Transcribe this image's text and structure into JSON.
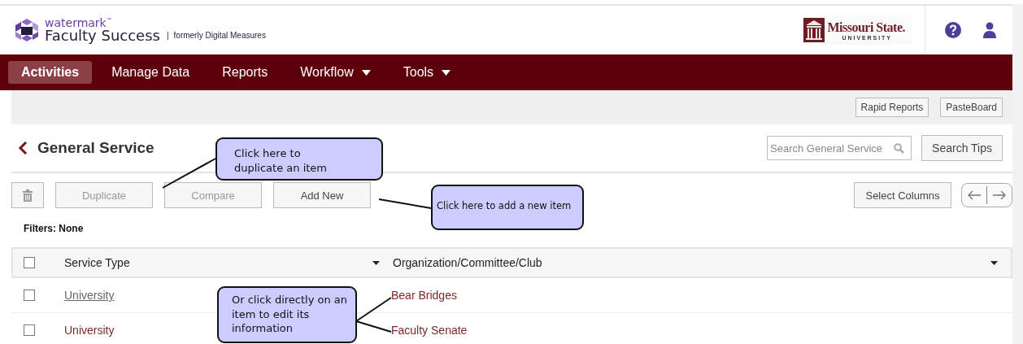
{
  "header": {
    "brand": "watermark",
    "brand_mark": "™",
    "product": "Faculty Success",
    "separator": "|",
    "tagline": "formerly Digital Measures",
    "university": "Missouri State.",
    "university_sub": "U N I V E R S I T Y"
  },
  "nav": [
    {
      "label": "Activities",
      "selected": true,
      "menu": false
    },
    {
      "label": "Manage Data",
      "selected": false,
      "menu": false
    },
    {
      "label": "Reports",
      "selected": false,
      "menu": false
    },
    {
      "label": "Workflow",
      "selected": false,
      "menu": true
    },
    {
      "label": "Tools",
      "selected": false,
      "menu": true
    }
  ],
  "subbar_buttons": [
    "Rapid Reports",
    "PasteBoard"
  ],
  "page_title": "General Service",
  "search": {
    "placeholder": "Search General Service"
  },
  "search_tips": "Search Tips",
  "toolbar": [
    {
      "label": "Duplicate",
      "disabled": true
    },
    {
      "label": "Compare",
      "disabled": true
    },
    {
      "label": "Add New",
      "disabled": false
    }
  ],
  "select_columns": "Select Columns",
  "filters": "Filters: None",
  "table": {
    "all_checked": false,
    "columns": [
      "Service Type",
      "Organization/Committee/Club"
    ],
    "rows": [
      {
        "checked": false,
        "hovered": true,
        "cells": [
          "University",
          "Bear Bridges"
        ]
      },
      {
        "checked": false,
        "hovered": false,
        "cells": [
          "University",
          "Faculty Senate"
        ]
      }
    ]
  },
  "callouts": [
    {
      "text": "Click here to duplicate an item"
    },
    {
      "text": "Click here to add a new item"
    },
    {
      "text": "Or click directly on an item to edit its information"
    }
  ]
}
